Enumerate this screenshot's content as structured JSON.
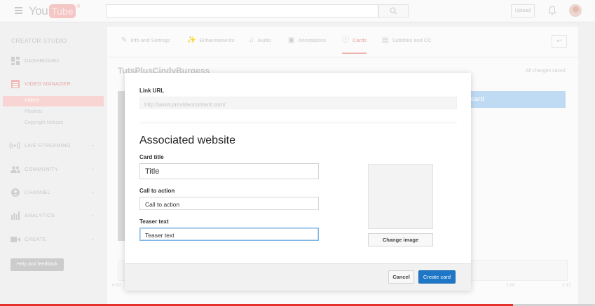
{
  "header": {
    "logo_you": "You",
    "logo_tube": "Tube",
    "logo_reg": "®",
    "upload_label": "Upload"
  },
  "sidebar": {
    "title": "CREATOR STUDIO",
    "items": [
      {
        "label": "DASHBOARD",
        "icon": "dashboard-icon"
      },
      {
        "label": "VIDEO MANAGER",
        "icon": "video-manager-icon"
      },
      {
        "label": "LIVE STREAMING",
        "icon": "live-streaming-icon"
      },
      {
        "label": "COMMUNITY",
        "icon": "community-icon"
      },
      {
        "label": "CHANNEL",
        "icon": "channel-icon"
      },
      {
        "label": "ANALYTICS",
        "icon": "analytics-icon"
      },
      {
        "label": "CREATE",
        "icon": "create-icon"
      }
    ],
    "sub_items": [
      {
        "label": "Videos",
        "selected": true
      },
      {
        "label": "Playlists",
        "selected": false
      },
      {
        "label": "Copyright Notices",
        "selected": false
      }
    ],
    "help_label": "Help and feedback"
  },
  "tabs": [
    {
      "label": "Info and Settings",
      "icon": "pencil-icon"
    },
    {
      "label": "Enhancements",
      "icon": "wand-icon"
    },
    {
      "label": "Audio",
      "icon": "music-note-icon"
    },
    {
      "label": "Annotations",
      "icon": "annotation-icon"
    },
    {
      "label": "Cards",
      "icon": "info-icon",
      "active": true
    },
    {
      "label": "Subtitles and CC",
      "icon": "subtitles-icon"
    }
  ],
  "main": {
    "video_title": "TutsPlusCindyBurgess",
    "saved_status": "All changes saved",
    "add_card_label": "d card",
    "timeline_left": "0:00",
    "timeline_mid": "2:00",
    "timeline_right": "2:17"
  },
  "modal": {
    "link_url_label": "Link URL",
    "link_url_placeholder": "http://www.provideocontent.com/",
    "section_title": "Associated website",
    "card_title_label": "Card title",
    "card_title_value": "Title",
    "cta_label": "Call to action",
    "cta_value": "Call to action",
    "teaser_label": "Teaser text",
    "teaser_value": "Teaser text",
    "change_image_label": "Change image",
    "cancel_label": "Cancel",
    "create_label": "Create card"
  },
  "colors": {
    "accent_red": "#e3312b",
    "primary_blue": "#1e77c6"
  }
}
